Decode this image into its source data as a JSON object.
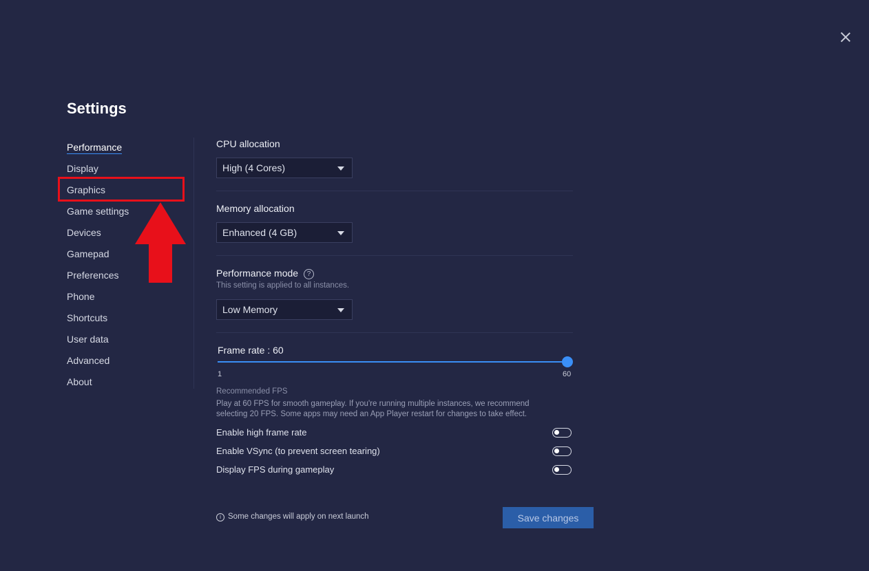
{
  "window": {
    "title": "Settings"
  },
  "sidebar": {
    "items": [
      {
        "label": "Performance"
      },
      {
        "label": "Display"
      },
      {
        "label": "Graphics"
      },
      {
        "label": "Game settings"
      },
      {
        "label": "Devices"
      },
      {
        "label": "Gamepad"
      },
      {
        "label": "Preferences"
      },
      {
        "label": "Phone"
      },
      {
        "label": "Shortcuts"
      },
      {
        "label": "User data"
      },
      {
        "label": "Advanced"
      },
      {
        "label": "About"
      }
    ],
    "active": "Performance"
  },
  "cpu": {
    "label": "CPU allocation",
    "value": "High (4 Cores)"
  },
  "memory": {
    "label": "Memory allocation",
    "value": "Enhanced (4 GB)"
  },
  "perf_mode": {
    "label": "Performance mode",
    "help": "?",
    "note": "This setting is applied to all instances.",
    "value": "Low Memory"
  },
  "frame_rate": {
    "label": "Frame rate : 60",
    "min": 1,
    "max": 60,
    "value": 60,
    "min_label": "1",
    "max_label": "60",
    "rec_title": "Recommended FPS",
    "rec_text_1": "Play at 60 FPS for smooth gameplay. If you're running multiple instances, we recommend",
    "rec_text_2": "selecting 20 FPS. Some apps may need an App Player restart for changes to take effect."
  },
  "toggles": [
    {
      "label": "Enable high frame rate",
      "on": false
    },
    {
      "label": "Enable VSync (to prevent screen tearing)",
      "on": false
    },
    {
      "label": "Display FPS during gameplay",
      "on": false
    }
  ],
  "footer": {
    "note_icon": "i",
    "note": "Some changes will apply on next launch",
    "save_label": "Save changes"
  },
  "colors": {
    "background": "#232744",
    "accent": "#3a8ff7",
    "annotation_red": "#e8101a",
    "save_button": "#2b5ea8"
  }
}
